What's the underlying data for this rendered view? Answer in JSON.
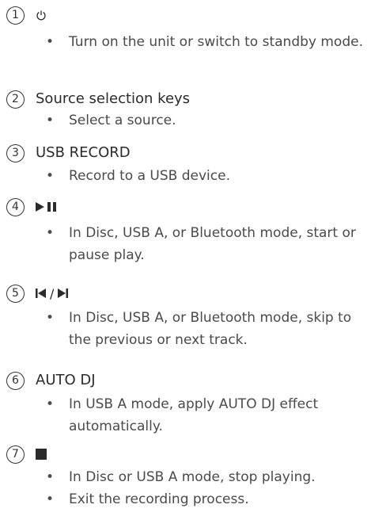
{
  "items": [
    {
      "number": "1",
      "icon": "power-icon",
      "bullets": [
        "Turn on the unit or switch to standby mode."
      ]
    },
    {
      "number": "2",
      "title": "Source selection keys",
      "bullets": [
        "Select a source."
      ]
    },
    {
      "number": "3",
      "title": "USB RECORD",
      "bullets": [
        "Record to a USB device."
      ]
    },
    {
      "number": "4",
      "icon": "play-pause-icon",
      "bullets": [
        "In Disc, USB A, or Bluetooth mode, start or pause play."
      ]
    },
    {
      "number": "5",
      "icon": "previous-next-icon",
      "icon_separator": "/",
      "bullets": [
        "In Disc, USB A, or Bluetooth mode, skip to the previous or next track."
      ]
    },
    {
      "number": "6",
      "title": "AUTO DJ",
      "bullets": [
        "In USB A mode, apply AUTO DJ effect automatically."
      ]
    },
    {
      "number": "7",
      "icon": "stop-icon",
      "bullets": [
        "In Disc or USB A mode, stop playing.",
        "Exit the recording process."
      ]
    }
  ]
}
